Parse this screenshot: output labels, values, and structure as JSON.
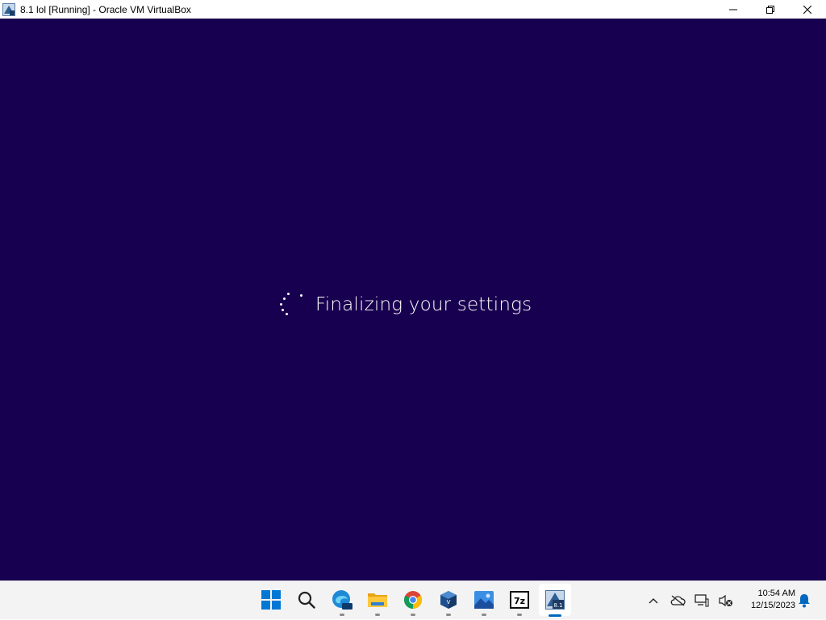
{
  "window": {
    "title": "8.1 lol [Running] - Oracle VM VirtualBox",
    "app_icon": "virtualbox-vm-icon",
    "controls": [
      "minimize-icon",
      "restore-icon",
      "close-icon"
    ]
  },
  "vm": {
    "background_color": "#180050",
    "status_text": "Finalizing your settings",
    "spinner_icon": "loading-spinner-icon"
  },
  "taskbar": {
    "apps": [
      {
        "name": "start",
        "icon": "windows-start-icon"
      },
      {
        "name": "search",
        "icon": "search-icon"
      },
      {
        "name": "edge-preview",
        "icon": "edge-beta-icon",
        "badge": "PRE"
      },
      {
        "name": "file-explorer",
        "icon": "folder-icon"
      },
      {
        "name": "chrome",
        "icon": "chrome-icon"
      },
      {
        "name": "virtualbox",
        "icon": "virtualbox-icon"
      },
      {
        "name": "photos",
        "icon": "photos-icon"
      },
      {
        "name": "7zip",
        "icon": "7zip-icon",
        "label": "7z"
      },
      {
        "name": "vm-window",
        "icon": "vm-8.1-icon",
        "label": "8.1",
        "active": true
      }
    ],
    "tray": {
      "icons": [
        "chevron-up-icon",
        "onedrive-offline-icon",
        "network-icon",
        "volume-muted-icon"
      ],
      "time": "10:54 AM",
      "date": "12/15/2023",
      "notification_icon": "bell-icon"
    },
    "accent_color": "#0067c0"
  }
}
